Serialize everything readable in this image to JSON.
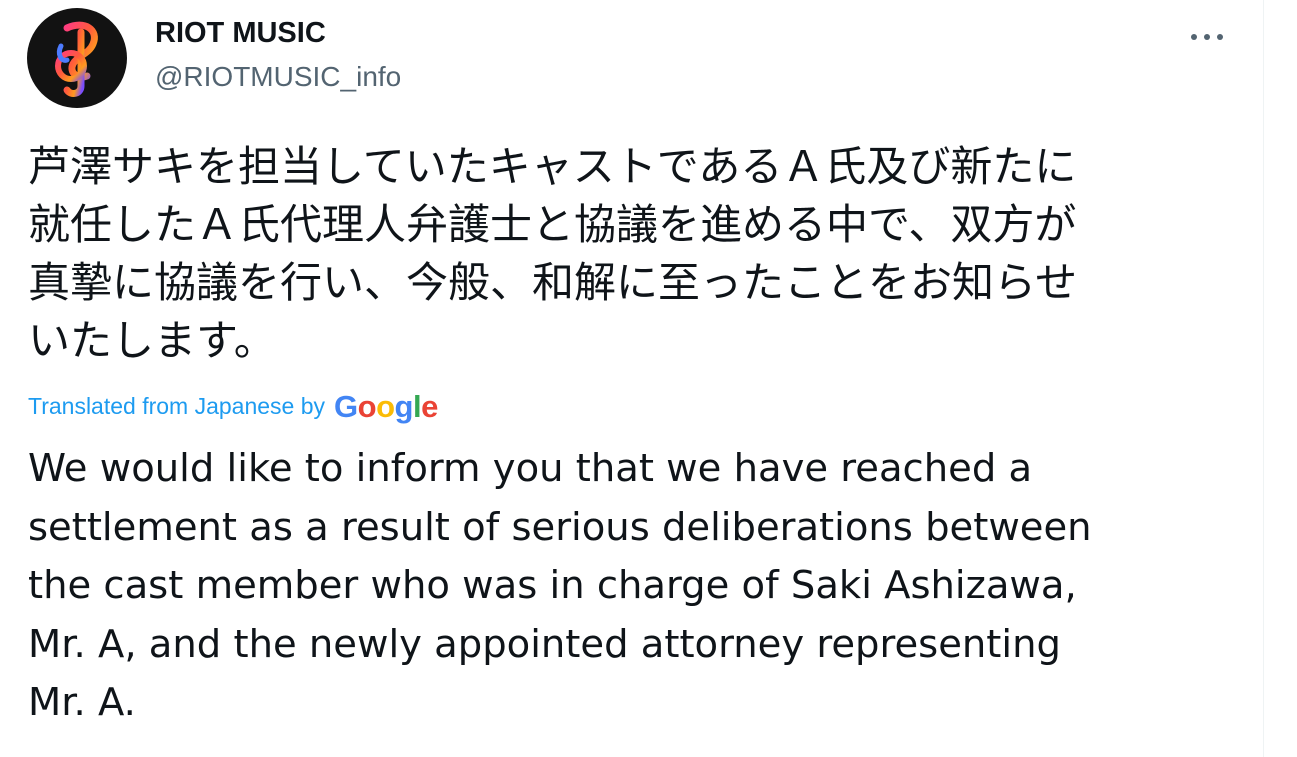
{
  "author": {
    "display_name": "RIOT MUSIC",
    "handle": "@RIOTMUSIC_info",
    "avatar_icon": "riot-music-logo-icon"
  },
  "more_button": {
    "icon": "more-horizontal-icon"
  },
  "tweet": {
    "text_ja": "芦澤サキを担当していたキャストであるＡ氏及び新たに\n就任したＡ氏代理人弁護士と協議を進める中で、双方が\n真摯に協議を行い、今般、和解に至ったことをお知らせ\nいたします。",
    "translated_label": "Translated from Japanese by",
    "translation_provider": "Google",
    "text_en": "We would like to inform you that we have reached a\nsettlement as a result of serious deliberations between\nthe cast member who was in charge of Saki Ashizawa,\nMr. A, and the newly appointed attorney representing\nMr. A."
  },
  "colors": {
    "text_primary": "#0f1419",
    "text_secondary": "#536471",
    "link": "#1d9bf0",
    "avatar_bg": "#121212"
  }
}
